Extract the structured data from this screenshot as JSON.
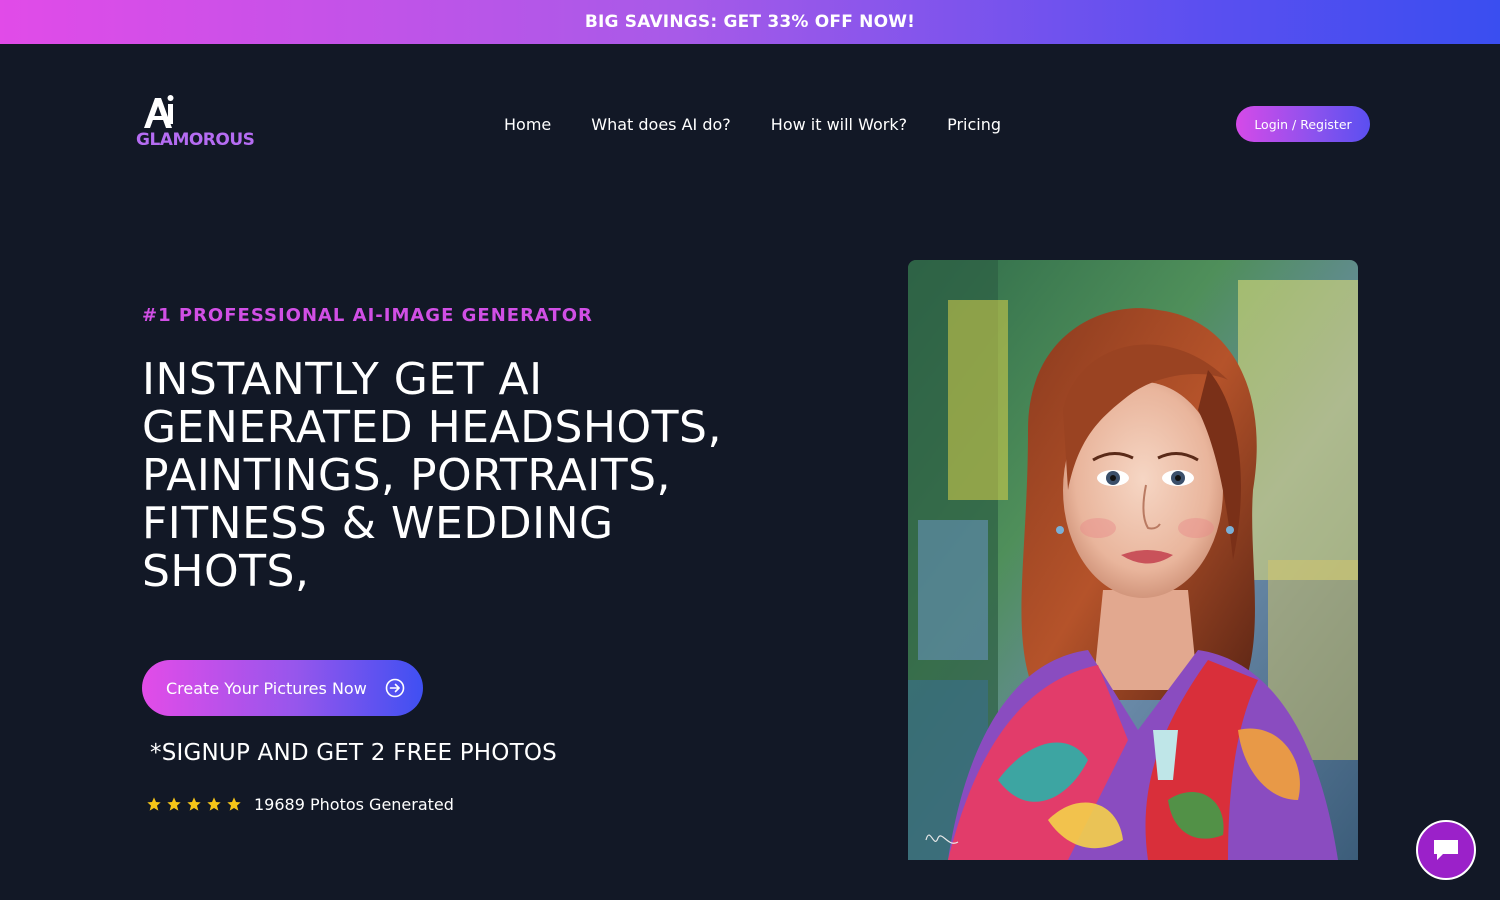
{
  "promo": {
    "text": "BIG SAVINGS: GET 33% OFF NOW!"
  },
  "brand": {
    "logo_text": "GLAMOROUS",
    "logo_mark": "AI"
  },
  "nav": {
    "items": [
      {
        "label": "Home"
      },
      {
        "label": "What does AI do?"
      },
      {
        "label": "How it will Work?"
      },
      {
        "label": "Pricing"
      }
    ],
    "login_label": "Login / Register"
  },
  "hero": {
    "eyebrow": "#1 PROFESSIONAL AI-IMAGE GENERATOR",
    "headline": "INSTANTLY GET AI GENERATED HEADSHOTS, PAINTINGS, PORTRAITS, FITNESS & WEDDING SHOTS,",
    "cta_label": "Create Your Pictures Now",
    "signup_note": "*SIGNUP AND GET 2 FREE PHOTOS",
    "rating_stars": 5,
    "photos_generated": "19689 Photos Generated",
    "image": "painted-portrait-woman"
  },
  "icons": {
    "cta": "arrow-circle-right-icon",
    "star": "star-icon",
    "chat": "chat-bubble-icon"
  },
  "colors": {
    "background": "#121826",
    "accent_pink": "#e14be8",
    "accent_blue": "#3a4ef0",
    "eyebrow": "#d14fe5",
    "star": "#f5c518",
    "chat": "#9b21c9"
  }
}
